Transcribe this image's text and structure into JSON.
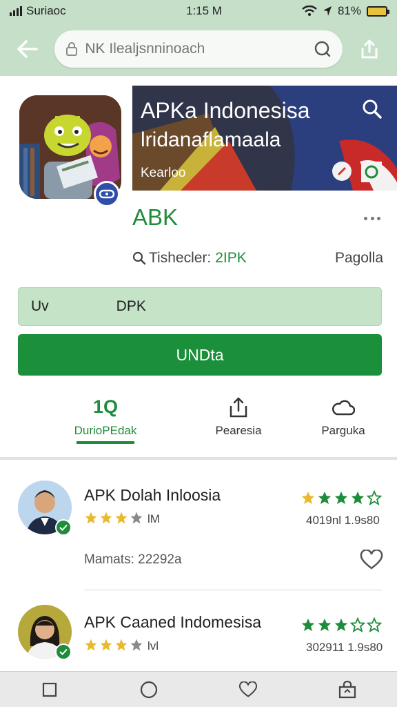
{
  "status_bar": {
    "carrier": "Suriaoc",
    "time": "1:15 M",
    "battery": "81%"
  },
  "search": {
    "placeholder": "NK Ilealjsnninoach"
  },
  "banner": {
    "title": "APKa Indonesisa",
    "subtitle": "lridanaflamaala",
    "small": "Kearloo"
  },
  "app": {
    "name": "ABK",
    "meta_label": "Tishecler:",
    "meta_value": "2IPK",
    "meta_right": "Pagolla"
  },
  "buttons": {
    "secondary_left": "Uv",
    "secondary_right": "DPK",
    "primary": "UNDta"
  },
  "tabs": [
    {
      "big": "1Q",
      "label": "DurioPEdak"
    },
    {
      "label": "Pearesia"
    },
    {
      "label": "Parguka"
    }
  ],
  "list": [
    {
      "title": "APK Dolah Inloosia",
      "rating_small": "lM",
      "stats": "4019nl 1.9s80",
      "price": "Mamats: 22292a"
    },
    {
      "title": "APK Caaned Indomesisa",
      "rating_small": "lvl",
      "stats": "302911 1.9s80"
    }
  ],
  "colors": {
    "accent_green": "#1b8f3a",
    "header_green": "#c6dfc9",
    "star_gold": "#e9b82c"
  }
}
